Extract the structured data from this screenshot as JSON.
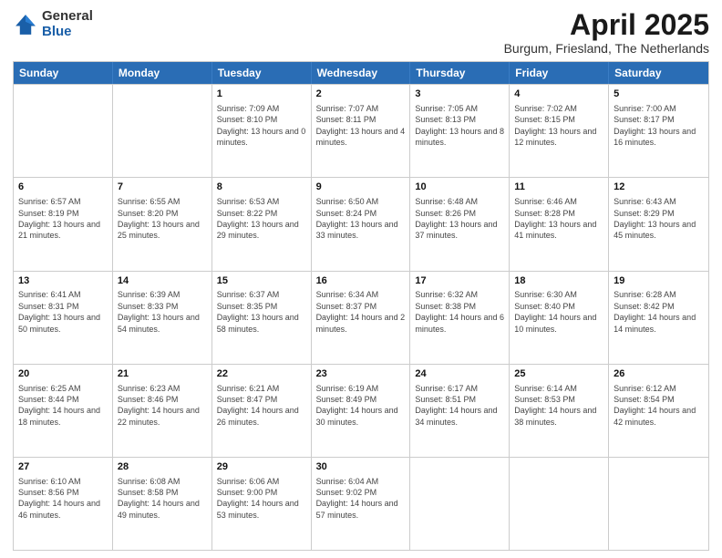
{
  "logo": {
    "general": "General",
    "blue": "Blue"
  },
  "title": "April 2025",
  "location": "Burgum, Friesland, The Netherlands",
  "header_days": [
    "Sunday",
    "Monday",
    "Tuesday",
    "Wednesday",
    "Thursday",
    "Friday",
    "Saturday"
  ],
  "weeks": [
    [
      {
        "day": "",
        "info": ""
      },
      {
        "day": "",
        "info": ""
      },
      {
        "day": "1",
        "info": "Sunrise: 7:09 AM\nSunset: 8:10 PM\nDaylight: 13 hours and 0 minutes."
      },
      {
        "day": "2",
        "info": "Sunrise: 7:07 AM\nSunset: 8:11 PM\nDaylight: 13 hours and 4 minutes."
      },
      {
        "day": "3",
        "info": "Sunrise: 7:05 AM\nSunset: 8:13 PM\nDaylight: 13 hours and 8 minutes."
      },
      {
        "day": "4",
        "info": "Sunrise: 7:02 AM\nSunset: 8:15 PM\nDaylight: 13 hours and 12 minutes."
      },
      {
        "day": "5",
        "info": "Sunrise: 7:00 AM\nSunset: 8:17 PM\nDaylight: 13 hours and 16 minutes."
      }
    ],
    [
      {
        "day": "6",
        "info": "Sunrise: 6:57 AM\nSunset: 8:19 PM\nDaylight: 13 hours and 21 minutes."
      },
      {
        "day": "7",
        "info": "Sunrise: 6:55 AM\nSunset: 8:20 PM\nDaylight: 13 hours and 25 minutes."
      },
      {
        "day": "8",
        "info": "Sunrise: 6:53 AM\nSunset: 8:22 PM\nDaylight: 13 hours and 29 minutes."
      },
      {
        "day": "9",
        "info": "Sunrise: 6:50 AM\nSunset: 8:24 PM\nDaylight: 13 hours and 33 minutes."
      },
      {
        "day": "10",
        "info": "Sunrise: 6:48 AM\nSunset: 8:26 PM\nDaylight: 13 hours and 37 minutes."
      },
      {
        "day": "11",
        "info": "Sunrise: 6:46 AM\nSunset: 8:28 PM\nDaylight: 13 hours and 41 minutes."
      },
      {
        "day": "12",
        "info": "Sunrise: 6:43 AM\nSunset: 8:29 PM\nDaylight: 13 hours and 45 minutes."
      }
    ],
    [
      {
        "day": "13",
        "info": "Sunrise: 6:41 AM\nSunset: 8:31 PM\nDaylight: 13 hours and 50 minutes."
      },
      {
        "day": "14",
        "info": "Sunrise: 6:39 AM\nSunset: 8:33 PM\nDaylight: 13 hours and 54 minutes."
      },
      {
        "day": "15",
        "info": "Sunrise: 6:37 AM\nSunset: 8:35 PM\nDaylight: 13 hours and 58 minutes."
      },
      {
        "day": "16",
        "info": "Sunrise: 6:34 AM\nSunset: 8:37 PM\nDaylight: 14 hours and 2 minutes."
      },
      {
        "day": "17",
        "info": "Sunrise: 6:32 AM\nSunset: 8:38 PM\nDaylight: 14 hours and 6 minutes."
      },
      {
        "day": "18",
        "info": "Sunrise: 6:30 AM\nSunset: 8:40 PM\nDaylight: 14 hours and 10 minutes."
      },
      {
        "day": "19",
        "info": "Sunrise: 6:28 AM\nSunset: 8:42 PM\nDaylight: 14 hours and 14 minutes."
      }
    ],
    [
      {
        "day": "20",
        "info": "Sunrise: 6:25 AM\nSunset: 8:44 PM\nDaylight: 14 hours and 18 minutes."
      },
      {
        "day": "21",
        "info": "Sunrise: 6:23 AM\nSunset: 8:46 PM\nDaylight: 14 hours and 22 minutes."
      },
      {
        "day": "22",
        "info": "Sunrise: 6:21 AM\nSunset: 8:47 PM\nDaylight: 14 hours and 26 minutes."
      },
      {
        "day": "23",
        "info": "Sunrise: 6:19 AM\nSunset: 8:49 PM\nDaylight: 14 hours and 30 minutes."
      },
      {
        "day": "24",
        "info": "Sunrise: 6:17 AM\nSunset: 8:51 PM\nDaylight: 14 hours and 34 minutes."
      },
      {
        "day": "25",
        "info": "Sunrise: 6:14 AM\nSunset: 8:53 PM\nDaylight: 14 hours and 38 minutes."
      },
      {
        "day": "26",
        "info": "Sunrise: 6:12 AM\nSunset: 8:54 PM\nDaylight: 14 hours and 42 minutes."
      }
    ],
    [
      {
        "day": "27",
        "info": "Sunrise: 6:10 AM\nSunset: 8:56 PM\nDaylight: 14 hours and 46 minutes."
      },
      {
        "day": "28",
        "info": "Sunrise: 6:08 AM\nSunset: 8:58 PM\nDaylight: 14 hours and 49 minutes."
      },
      {
        "day": "29",
        "info": "Sunrise: 6:06 AM\nSunset: 9:00 PM\nDaylight: 14 hours and 53 minutes."
      },
      {
        "day": "30",
        "info": "Sunrise: 6:04 AM\nSunset: 9:02 PM\nDaylight: 14 hours and 57 minutes."
      },
      {
        "day": "",
        "info": ""
      },
      {
        "day": "",
        "info": ""
      },
      {
        "day": "",
        "info": ""
      }
    ]
  ]
}
